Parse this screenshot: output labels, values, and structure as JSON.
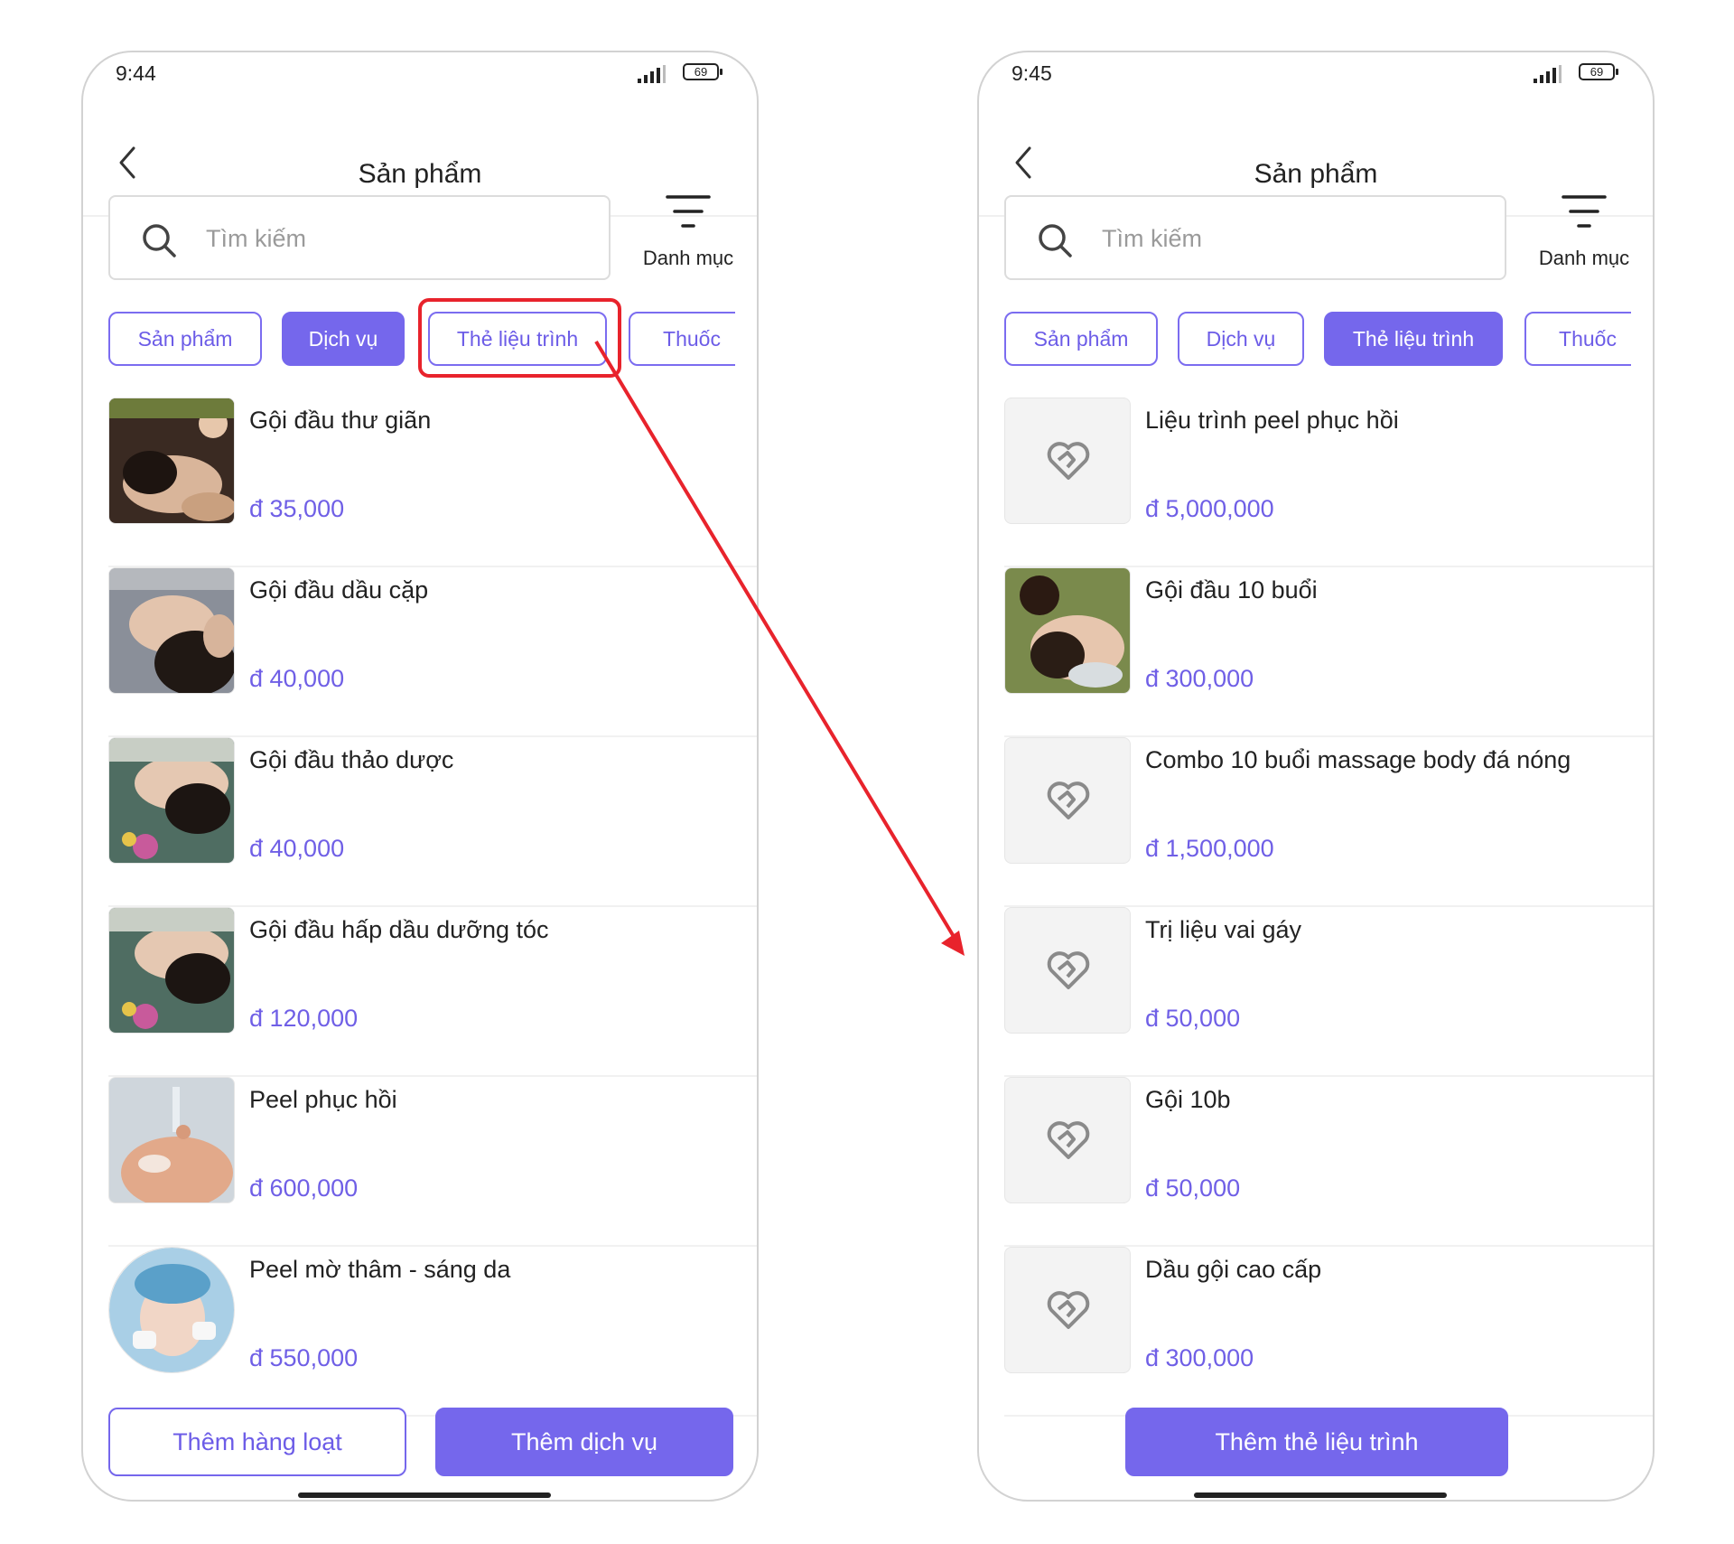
{
  "left_screen": {
    "status": {
      "time": "9:44",
      "battery": "69"
    },
    "header": {
      "title": "Sản phẩm"
    },
    "search": {
      "placeholder": "Tìm kiếm"
    },
    "category_label": "Danh mục",
    "tabs": [
      {
        "label": "Sản phẩm",
        "active": false
      },
      {
        "label": "Dịch vụ",
        "active": true
      },
      {
        "label": "Thẻ liệu trình",
        "active": false
      },
      {
        "label": "Thuốc",
        "active": false
      }
    ],
    "items": [
      {
        "name": "Gội đầu thư giãn",
        "price": "đ 35,000"
      },
      {
        "name": "Gội đầu dầu cặp",
        "price": "đ 40,000"
      },
      {
        "name": "Gội đầu thảo dược",
        "price": "đ 40,000"
      },
      {
        "name": "Gội đầu hấp dầu dưỡng tóc",
        "price": "đ 120,000"
      },
      {
        "name": "Peel phục hồi",
        "price": "đ 600,000"
      },
      {
        "name": "Peel mờ thâm - sáng da",
        "price": "đ 550,000"
      }
    ],
    "buttons": {
      "bulk_add": "Thêm hàng loạt",
      "add_service": "Thêm dịch vụ"
    }
  },
  "right_screen": {
    "status": {
      "time": "9:45",
      "battery": "69"
    },
    "header": {
      "title": "Sản phẩm"
    },
    "search": {
      "placeholder": "Tìm kiếm"
    },
    "category_label": "Danh mục",
    "tabs": [
      {
        "label": "Sản phẩm",
        "active": false
      },
      {
        "label": "Dịch vụ",
        "active": false
      },
      {
        "label": "Thẻ liệu trình",
        "active": true
      },
      {
        "label": "Thuốc",
        "active": false
      }
    ],
    "items": [
      {
        "name": "Liệu trình peel phục hồi",
        "price": "đ 5,000,000"
      },
      {
        "name": "Gội đầu 10 buổi",
        "price": "đ 300,000"
      },
      {
        "name": "Combo 10 buổi massage body đá nóng",
        "price": "đ 1,500,000"
      },
      {
        "name": "Trị liệu vai gáy",
        "price": "đ 50,000"
      },
      {
        "name": "Gội 10b",
        "price": "đ 50,000"
      },
      {
        "name": "Dầu gội cao cấp",
        "price": "đ 300,000"
      }
    ],
    "buttons": {
      "add_card": "Thêm thẻ liệu trình"
    }
  },
  "colors": {
    "accent": "#7567ec",
    "annotation": "#e8232c"
  },
  "icons": [
    "back-arrow-icon",
    "search-icon",
    "filter-icon",
    "signal-icon",
    "battery-icon",
    "placeholder-heart-icon"
  ]
}
